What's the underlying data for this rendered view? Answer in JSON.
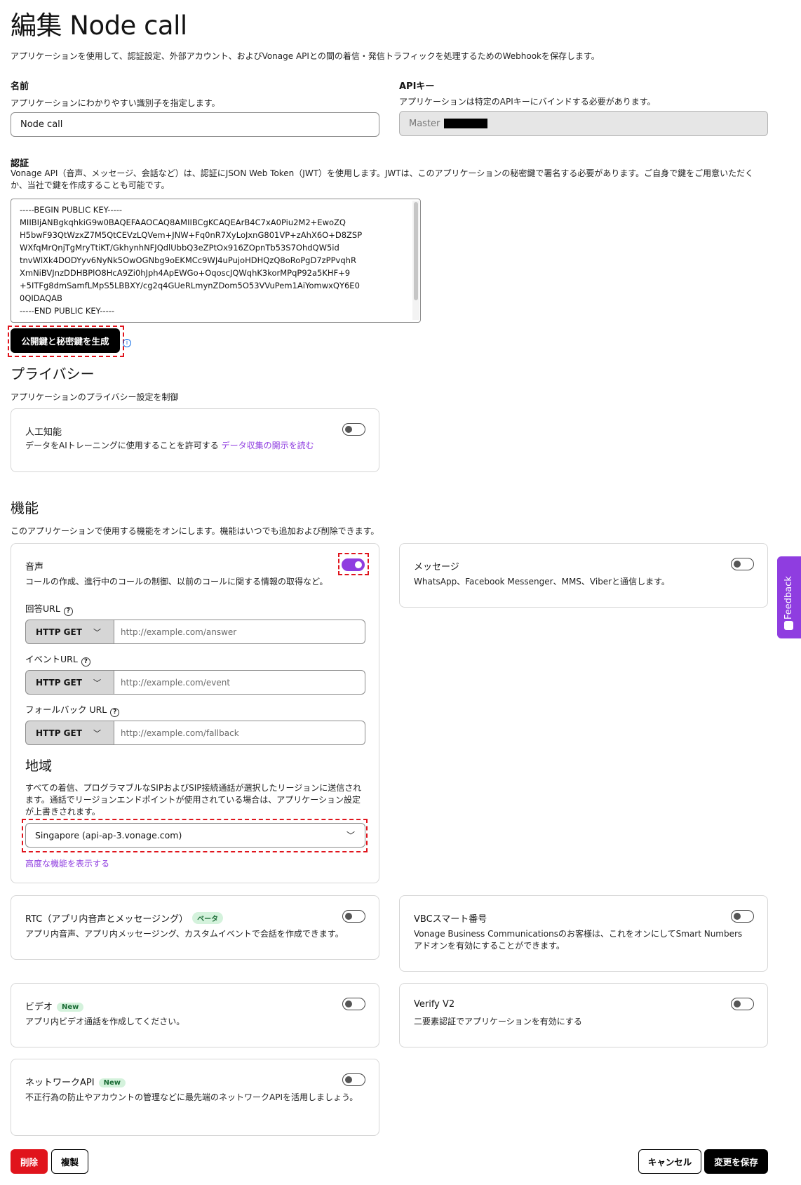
{
  "page": {
    "title": "編集 Node call",
    "intro": "アプリケーションを使用して、認証設定、外部アカウント、およびVonage APIとの間の着信・発信トラフィックを処理するためのWebhookを保存します。"
  },
  "name": {
    "label": "名前",
    "hint": "アプリケーションにわかりやすい識別子を指定します。",
    "value": "Node call"
  },
  "api_key": {
    "label": "APIキー",
    "hint": "アプリケーションは特定のAPIキーにバインドする必要があります。",
    "value": "Master"
  },
  "auth": {
    "label": "認証",
    "desc": "Vonage API（音声、メッセージ、会話など）は、認証にJSON Web Token（JWT）を使用します。JWTは、このアプリケーションの秘密鍵で署名する必要があります。ご自身で鍵をご用意いただくか、当社で鍵を作成することも可能です。",
    "public_key": "-----BEGIN PUBLIC KEY-----\nMIIBIjANBgkqhkiG9w0BAQEFAAOCAQ8AMIIBCgKCAQEArB4C7xA0Piu2M2+EwoZQ\nH5bwF93QtWzxZ7M5QtCEVzLQVem+JNW+Fq0nR7XyLoJxnG801VP+zAhX6O+D8ZSP\nWXfqMrQnjTgMryTtiKT/GkhynhNFJQdlUbbQ3eZPtOx916ZOpnTb53S7OhdQW5id\ntnvWlXk4DODYyv6NyNk5OwOGNbg9oEKMCc9WJ4uPujoHDHQzQ8oRoPgD7zPPvqhR\nXmNiBVJnzDDHBPlO8HcA9Zi0hJph4ApEWGo+OqoscJQWqhK3korMPqP92a5KHF+9\n+5ITFg8dmSamfLMpS5LBBXY/cg2q4GUeRLmynZDom5O53VVuPem1AiYomwxQY6E0\n0QIDAQAB\n-----END PUBLIC KEY-----",
    "generate_button": "公開鍵と秘密鍵を生成",
    "info_icon": "info-icon"
  },
  "privacy": {
    "heading": "プライバシー",
    "hint": "アプリケーションのプライバシー設定を制御",
    "ai": {
      "title": "人工知能",
      "desc": "データをAIトレーニングに使用することを許可する",
      "link": "データ収集の開示を読む",
      "enabled": false
    }
  },
  "features": {
    "heading": "機能",
    "hint": "このアプリケーションで使用する機能をオンにします。機能はいつでも追加および削除できます。",
    "voice": {
      "title": "音声",
      "desc": "コールの作成、進行中のコールの制御、以前のコールに関する情報の取得など。",
      "enabled": true,
      "answer_label": "回答URL",
      "event_label": "イベントURL",
      "fallback_label": "フォールバック URL",
      "method": "HTTP GET",
      "answer_placeholder": "http://example.com/answer",
      "event_placeholder": "http://example.com/event",
      "fallback_placeholder": "http://example.com/fallback",
      "region_heading": "地域",
      "region_desc": "すべての着信、プログラマブルなSIPおよびSIP接続通話が選択したリージョンに送信されます。通話でリージョンエンドポイントが使用されている場合は、アプリケーション設定が上書きされます。",
      "region_value": "Singapore (api-ap-3.vonage.com)",
      "advanced_link": "高度な機能を表示する"
    },
    "messages": {
      "title": "メッセージ",
      "desc": "WhatsApp、Facebook Messenger、MMS、Viberと通信します。",
      "enabled": false
    },
    "rtc": {
      "title": "RTC（アプリ内音声とメッセージング）",
      "badge": "ベータ",
      "desc": "アプリ内音声、アプリ内メッセージング、カスタムイベントで会話を作成できます。",
      "enabled": false
    },
    "vbc": {
      "title": "VBCスマート番号",
      "desc": "Vonage Business Communicationsのお客様は、これをオンにしてSmart Numbersアドオンを有効にすることができます。",
      "enabled": false
    },
    "video": {
      "title": "ビデオ",
      "badge": "New",
      "desc": "アプリ内ビデオ通話を作成してください。",
      "enabled": false
    },
    "verify": {
      "title": "Verify V2",
      "desc": "二要素認証でアプリケーションを有効にする",
      "enabled": false
    },
    "network": {
      "title": "ネットワークAPI",
      "badge": "New",
      "desc": "不正行為の防止やアカウントの管理などに最先端のネットワークAPIを活用しましょう。",
      "enabled": false
    }
  },
  "footer": {
    "delete": "削除",
    "duplicate": "複製",
    "cancel": "キャンセル",
    "save": "変更を保存"
  },
  "feedback": {
    "label": "Feedback"
  },
  "colors": {
    "accent": "#8f3de0",
    "danger": "#e0141c",
    "badge_bg": "#d4f2dc"
  }
}
